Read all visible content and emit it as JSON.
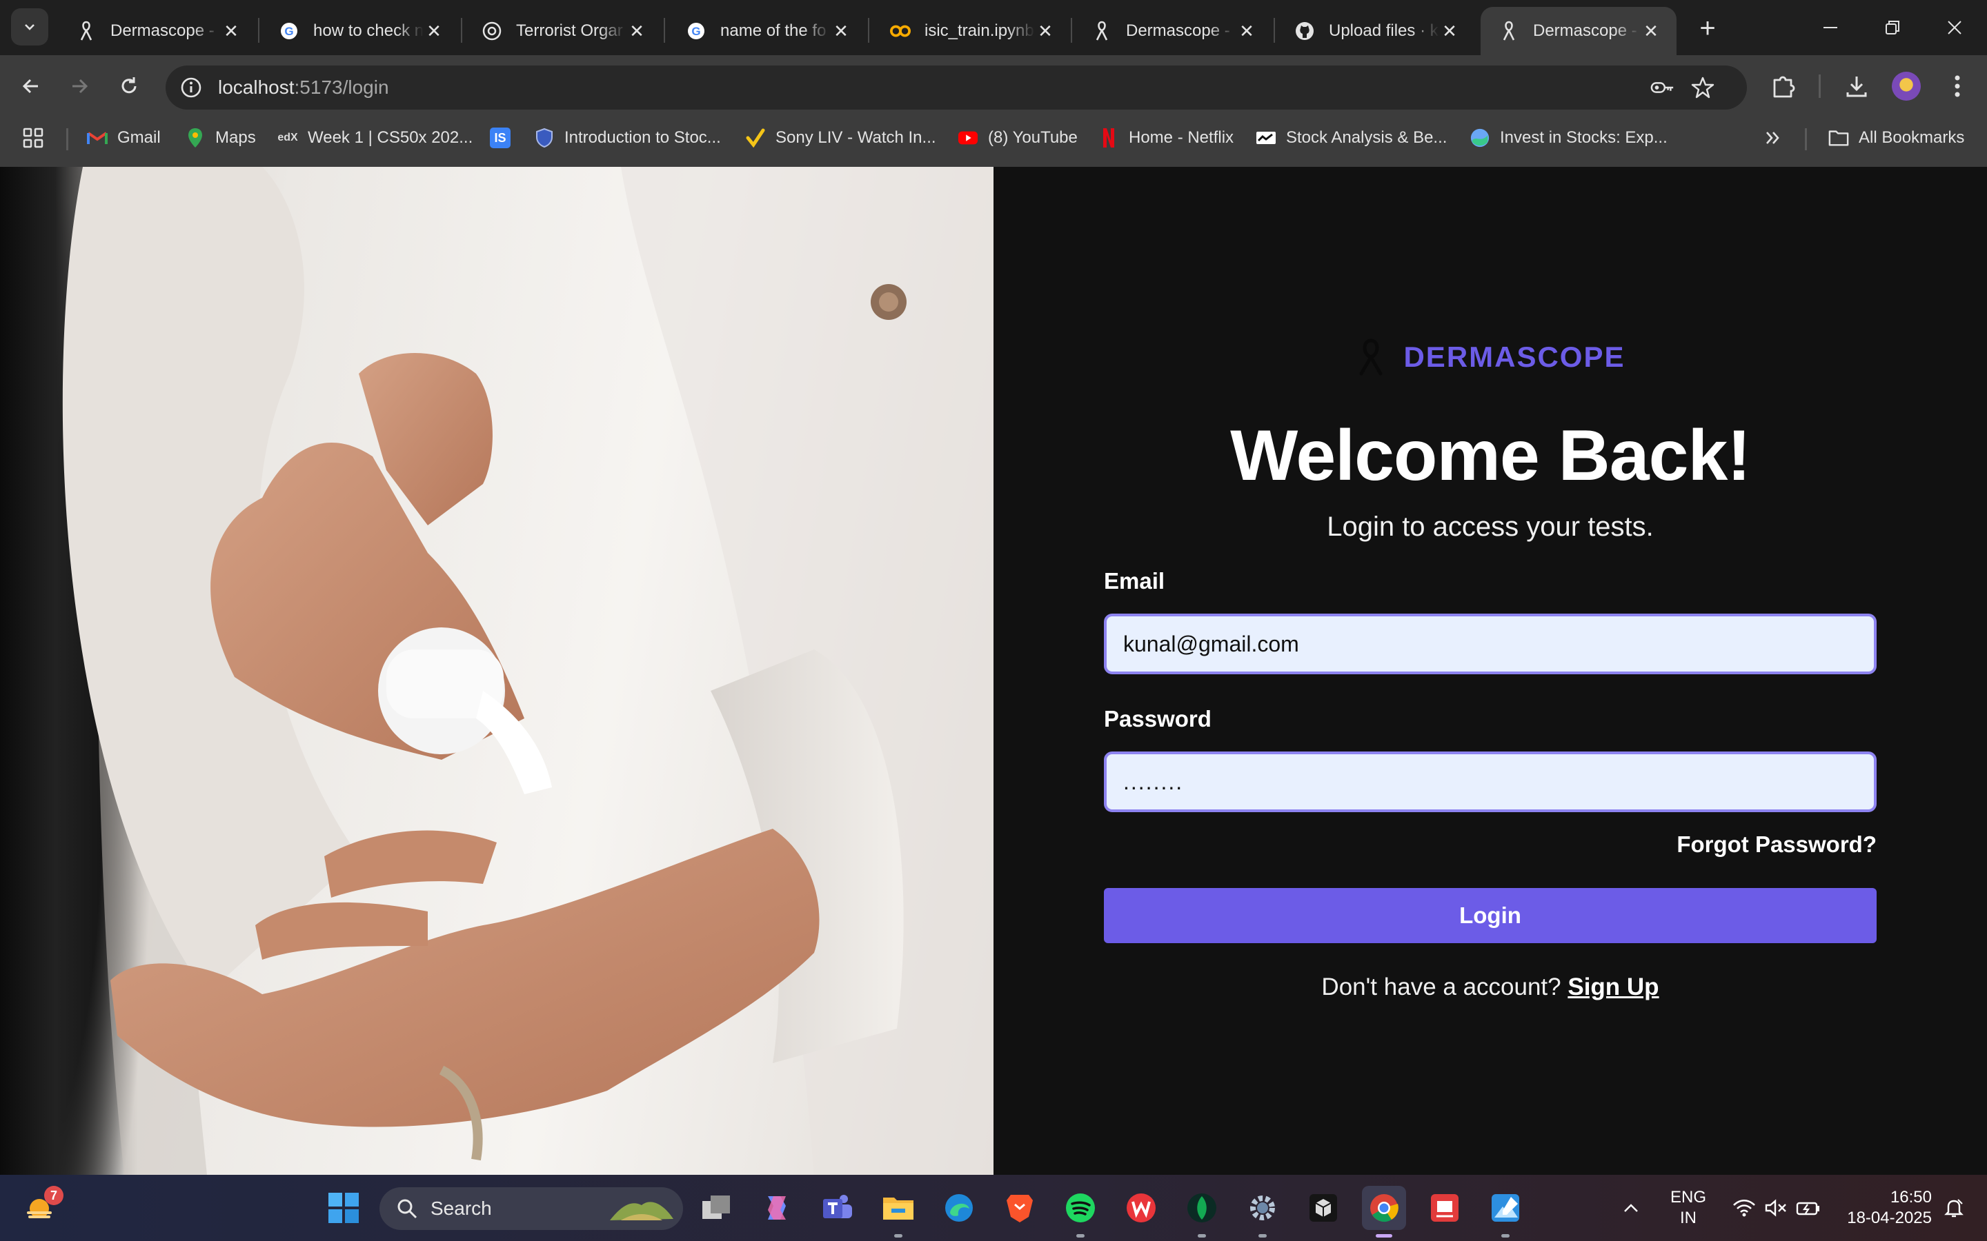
{
  "browser": {
    "tabs": [
      {
        "title": "Dermascope - ",
        "icon": "dermascope-ribbon-icon",
        "active": false
      },
      {
        "title": "how to check n",
        "icon": "google-icon",
        "active": false
      },
      {
        "title": "Terrorist Orgar",
        "icon": "chatgpt-icon",
        "active": false
      },
      {
        "title": "name of the fo",
        "icon": "google-icon",
        "active": false
      },
      {
        "title": "isic_train.ipynb",
        "icon": "colab-icon",
        "active": false
      },
      {
        "title": "Dermascope - ",
        "icon": "dermascope-ribbon-icon",
        "active": false
      },
      {
        "title": "Upload files · k",
        "icon": "github-icon",
        "active": false
      },
      {
        "title": "Dermascope - ",
        "icon": "dermascope-ribbon-icon",
        "active": true
      }
    ],
    "url_host": "localhost",
    "url_path": ":5173/login",
    "bookmarks": [
      {
        "label": "Gmail",
        "icon": "gmail-icon"
      },
      {
        "label": "Maps",
        "icon": "maps-icon"
      },
      {
        "label": "Week 1 | CS50x 202...",
        "icon": "edx-icon"
      },
      {
        "label": "",
        "icon": "is-icon"
      },
      {
        "label": "Introduction to Stoc...",
        "icon": "shield-icon"
      },
      {
        "label": "Sony LIV - Watch In...",
        "icon": "sonyliv-icon"
      },
      {
        "label": "(8) YouTube",
        "icon": "youtube-icon"
      },
      {
        "label": "Home - Netflix",
        "icon": "netflix-icon"
      },
      {
        "label": "Stock Analysis & Be...",
        "icon": "stock-icon"
      },
      {
        "label": "Invest in Stocks: Exp...",
        "icon": "invest-icon"
      }
    ],
    "all_bookmarks": "All Bookmarks"
  },
  "login": {
    "brand": "DERMASCOPE",
    "title": "Welcome Back!",
    "subtitle": "Login to access your tests.",
    "email_label": "Email",
    "email_value": "kunal@gmail.com",
    "password_label": "Password",
    "password_value": "........",
    "forgot": "Forgot Password?",
    "button": "Login",
    "signup_prompt": "Don't have a account?",
    "signup_link": "Sign Up",
    "accent_color": "#6c5ce7"
  },
  "taskbar": {
    "search_placeholder": "Search",
    "weather_badge": "7",
    "lang_line1": "ENG",
    "lang_line2": "IN",
    "time": "16:50",
    "date": "18-04-2025"
  }
}
